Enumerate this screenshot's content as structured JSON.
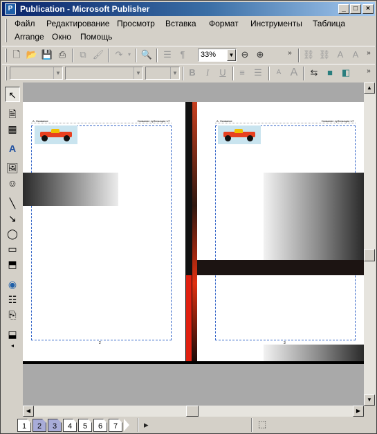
{
  "window": {
    "title": "Publication - Microsoft Publisher",
    "app_icon": "P"
  },
  "menu": {
    "row1": [
      "Файл",
      "Редактирование",
      "Просмотр",
      "Вставка",
      "Формат",
      "Инструменты",
      "Таблица"
    ],
    "row2": [
      "Arrange",
      "Окно",
      "Помощь"
    ]
  },
  "toolbar": {
    "zoom_value": "33%"
  },
  "pages": {
    "left": {
      "header_left": "A. Название",
      "header_right": "Название публикации 1/7",
      "footer_number": "2"
    },
    "right": {
      "header_left": "A. Название",
      "header_right": "Название публикации 1/7",
      "footer_number": "3"
    }
  },
  "page_navigator": {
    "pages": [
      "1",
      "2",
      "3",
      "4",
      "5",
      "6",
      "7"
    ],
    "selected": [
      "2",
      "3"
    ]
  },
  "colors": {
    "accent_red": "#e03010",
    "guide_blue": "#3264c8",
    "title_bar": "#0a246a"
  }
}
